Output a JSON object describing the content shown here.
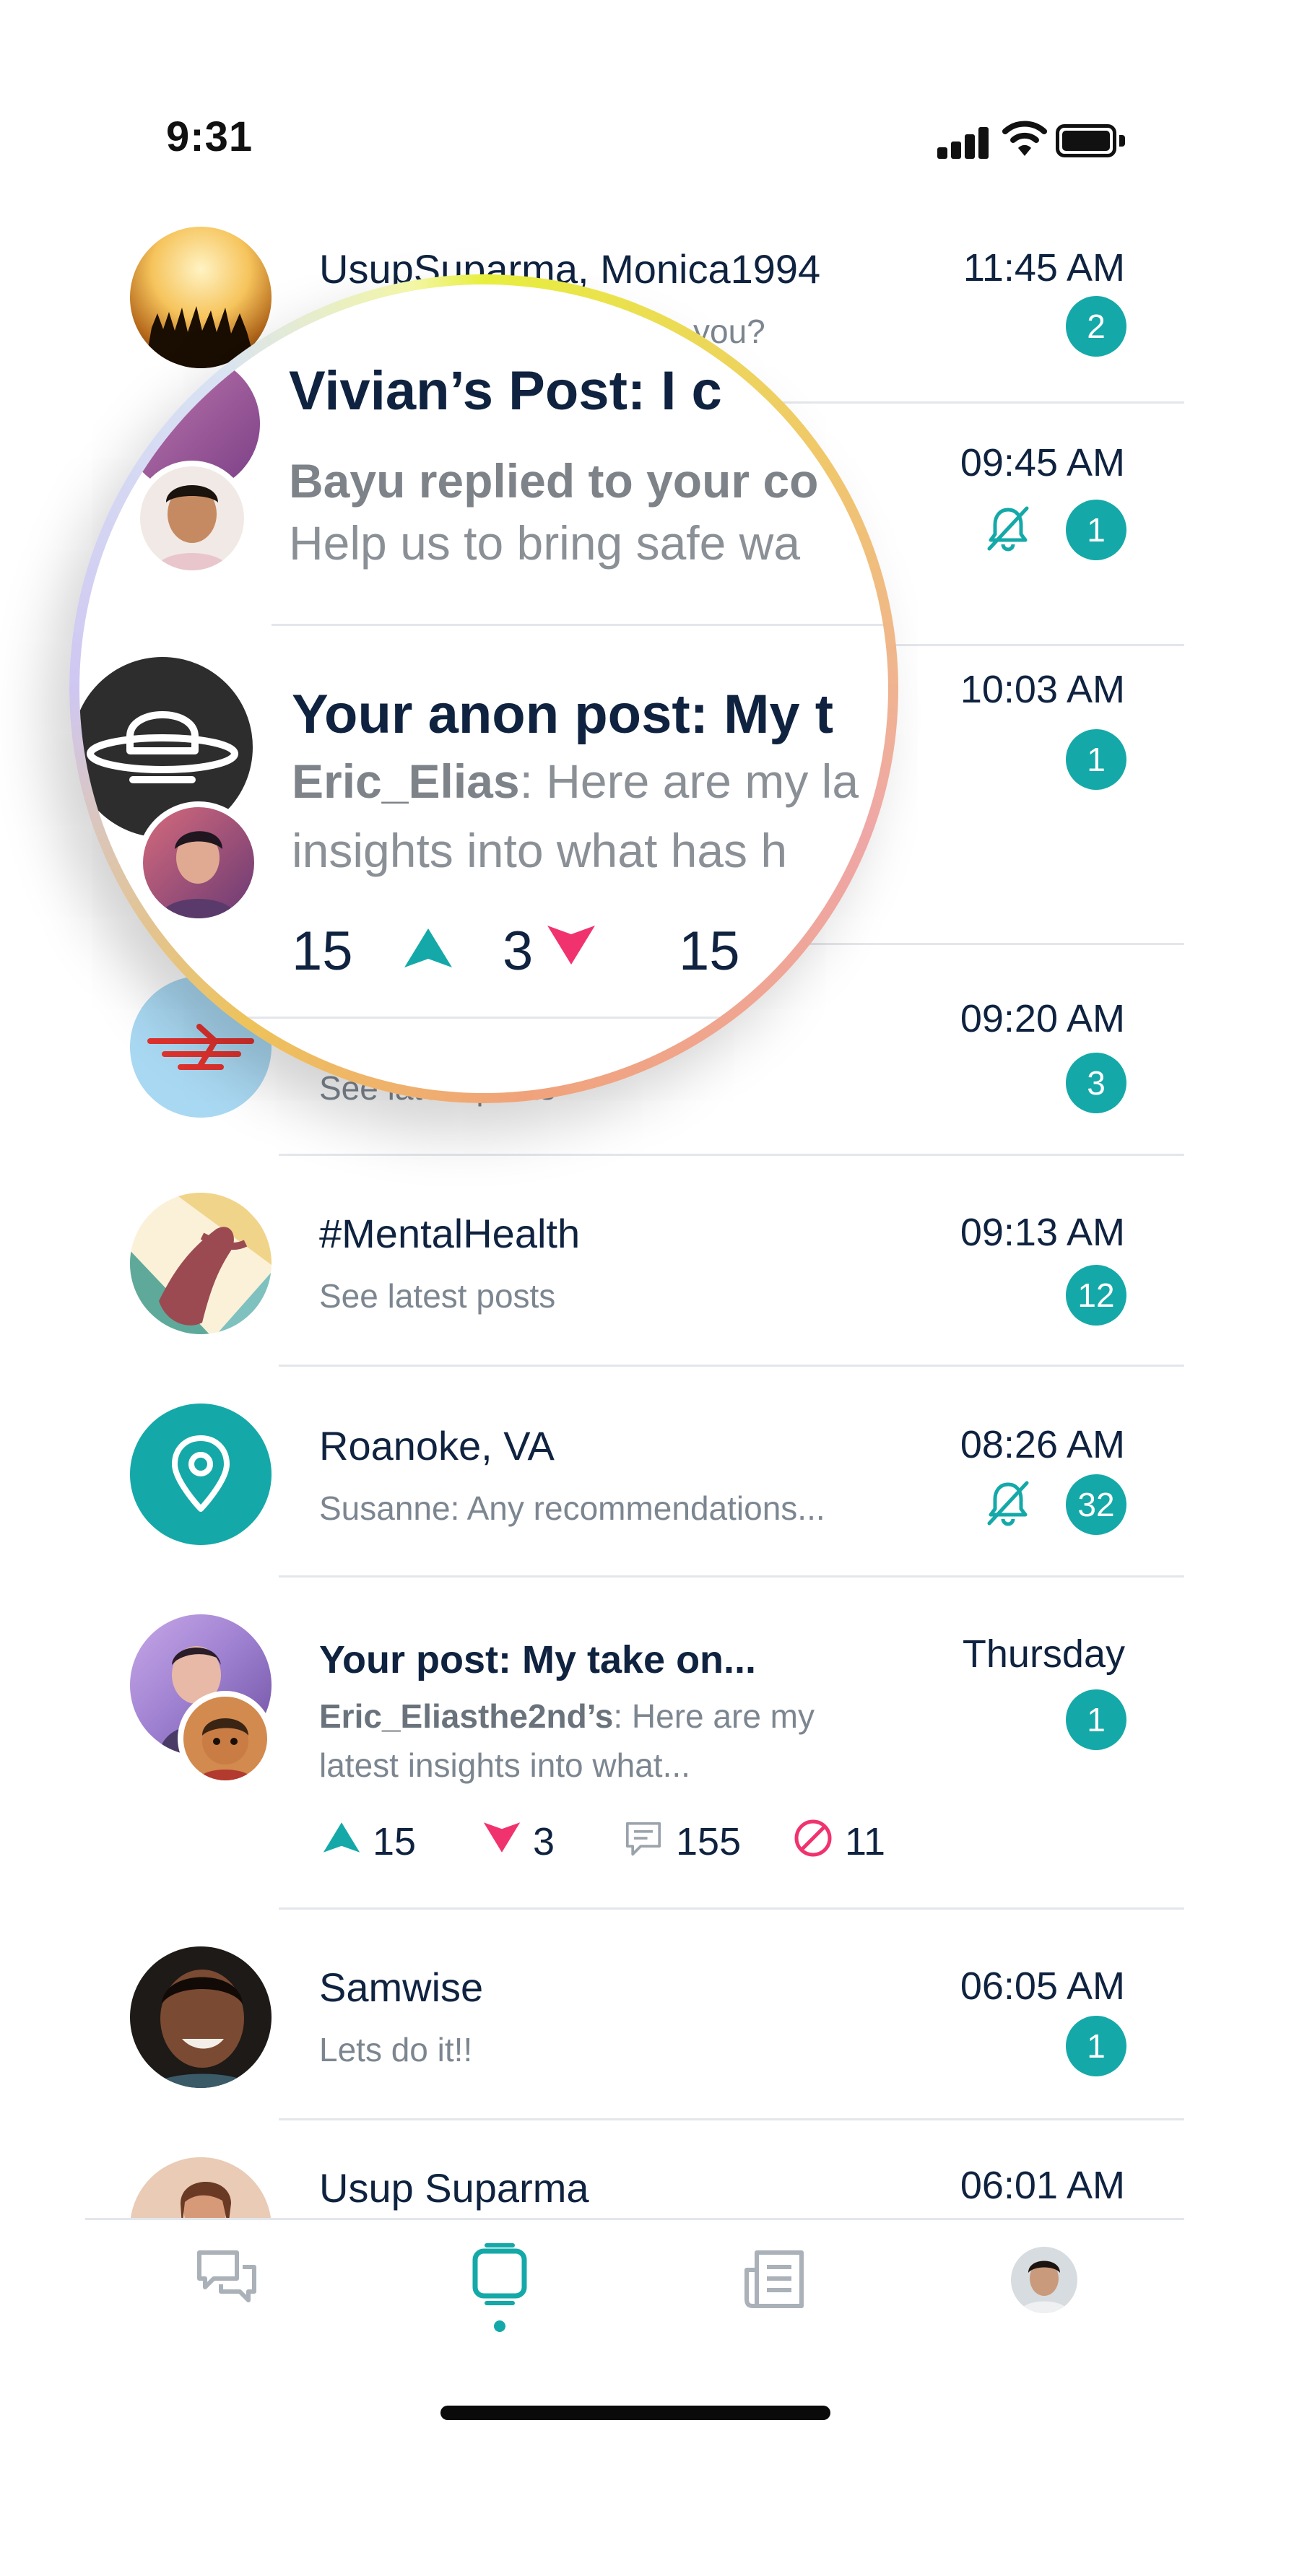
{
  "status_bar": {
    "time": "9:31"
  },
  "colors": {
    "accent": "#14a9a8",
    "downvote": "#f0336f",
    "navy": "#0f2340"
  },
  "conversations": [
    {
      "title": "UsupSuparma, Monica1994",
      "subtitle": "you?",
      "time": "11:45 AM",
      "badge": "2"
    },
    {
      "title": "Vivian’s Post: I c",
      "subtitle_bold": "Bayu replied to your co",
      "subtitle": "Help us to bring safe wa",
      "time": "09:45 AM",
      "badge": "1",
      "muted": true
    },
    {
      "title": "Your anon post: My t",
      "author": "Eric_Elias",
      "subtitle": ": Here are my la",
      "subtitle2": "insights into what has h",
      "time": "10:03 AM",
      "badge": "1",
      "upvotes": "15",
      "downvotes": "3",
      "comments": "15"
    },
    {
      "title": "",
      "subtitle": "See latest posts",
      "time": "09:20 AM",
      "badge": "3"
    },
    {
      "title": "#MentalHealth",
      "subtitle": "See latest posts",
      "time": "09:13 AM",
      "badge": "12"
    },
    {
      "title": "Roanoke, VA",
      "subtitle": "Susanne: Any recommendations...",
      "time": "08:26 AM",
      "badge": "32",
      "muted": true
    },
    {
      "title": "Your post: My take on...",
      "author": "Eric_Eliasthe2nd’s",
      "subtitle": ": Here are my",
      "subtitle2": "latest insights into what...",
      "time": "Thursday",
      "badge": "1",
      "upvotes": "15",
      "downvotes": "3",
      "comments": "155",
      "blocked": "11"
    },
    {
      "title": "Samwise",
      "subtitle": "Lets do it!!",
      "time": "06:05 AM",
      "badge": "1"
    },
    {
      "title": "Usup Suparma",
      "time": "06:01 AM"
    }
  ],
  "nav": {
    "items": [
      {
        "icon": "chat-bubbles-icon"
      },
      {
        "icon": "feed-icon",
        "active": true
      },
      {
        "icon": "news-icon"
      },
      {
        "icon": "profile-avatar"
      }
    ]
  }
}
